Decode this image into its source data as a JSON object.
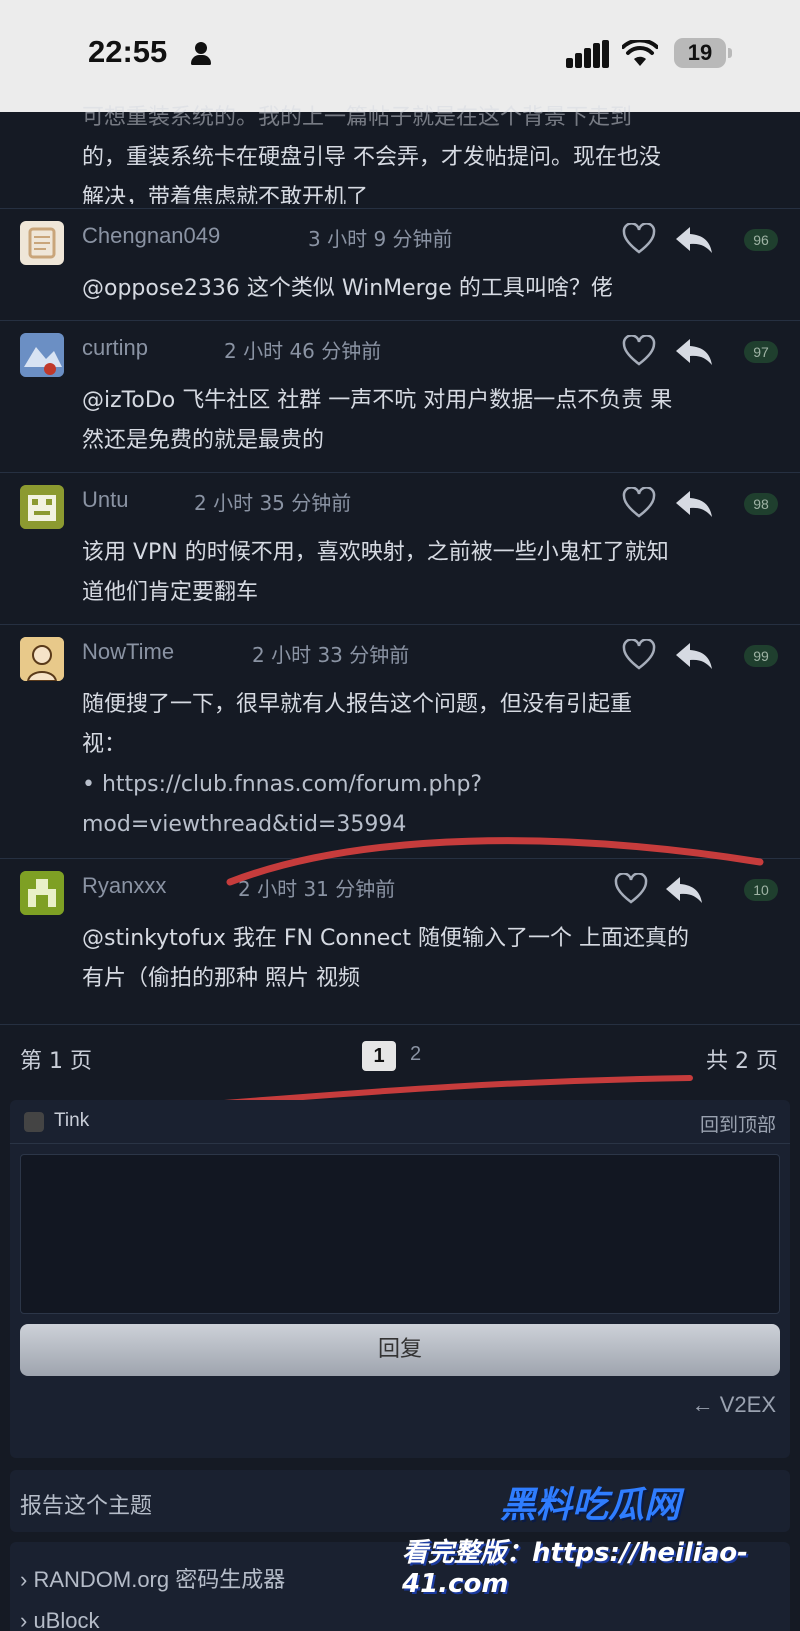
{
  "status_bar": {
    "time": "22:55",
    "battery": "19"
  },
  "cut_text": {
    "line1": "可想重装系统的。我的上一篇帖子就是在这个背景下走到",
    "line2": "的，重装系统卡在硬盘引导 不会弄，才发帖提问。现在也没",
    "line3": "解决，带着焦虑就不敢开机了"
  },
  "replies": [
    {
      "username": "Chengnan049",
      "time": "3 小时 9 分钟前",
      "floor": "96",
      "lines": [
        "@oppose2336 这个类似 WinMerge 的工具叫啥？佬"
      ]
    },
    {
      "username": "curtinp",
      "time": "2 小时 46 分钟前",
      "floor": "97",
      "lines": [
        "@izToDo 飞牛社区 社群 一声不吭 对用户数据一点不负责 果",
        "然还是免费的就是最贵的"
      ]
    },
    {
      "username": "Untu",
      "time": "2 小时 35 分钟前",
      "floor": "98",
      "lines": [
        "该用 VPN 的时候不用，喜欢映射，之前被一些小鬼杠了就知",
        "道他们肯定要翻车"
      ]
    },
    {
      "username": "NowTime",
      "time": "2 小时 33 分钟前",
      "floor": "99",
      "lines": [
        "随便搜了一下，很早就有人报告这个问题，但没有引起重",
        "视："
      ],
      "link_bullet": "•",
      "link_line1": "https://club.fnnas.com/forum.php?",
      "link_line2": "mod=viewthread&tid=35994"
    },
    {
      "username": "Ryanxxx",
      "time": "2 小时 31 分钟前",
      "floor": "10",
      "lines": [
        "@stinkytofux 我在 FN Connect 随便输入了一个 上面还真的",
        "有片（偷拍的那种 照片 视频"
      ]
    }
  ],
  "pager": {
    "left": "第 1 页",
    "current": "1",
    "next": "2",
    "right": "共 2 页"
  },
  "reply_box": {
    "username": "Tink",
    "back_to_top": "回到顶部",
    "button": "回复",
    "site_link": "← V2EX"
  },
  "report": {
    "label": "报告这个主题"
  },
  "links": [
    "› RANDOM.org 密码生成器",
    "› uBlock"
  ],
  "watermark": {
    "title": "黑料吃瓜网",
    "url": "看完整版：https://heiliao-41.com"
  },
  "colors": {
    "background": "#151a24",
    "red_annotation": "#d9403f",
    "watermark_blue": "#2f7dff"
  }
}
